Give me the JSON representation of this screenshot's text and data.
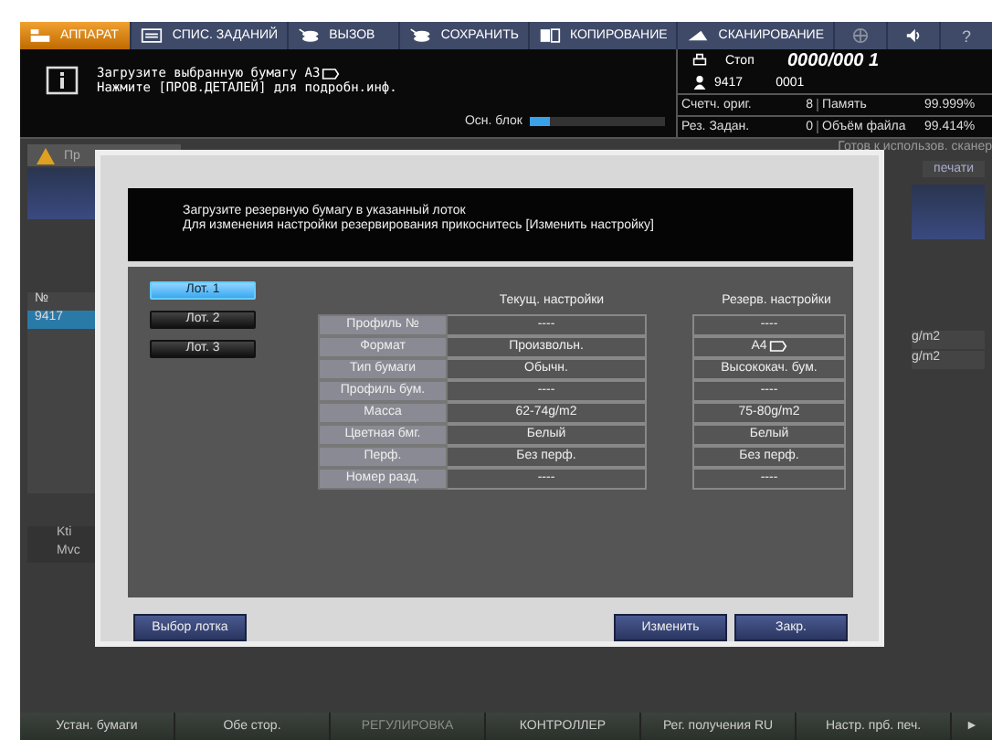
{
  "top_tabs": [
    {
      "label": "АППАРАТ",
      "selected": true
    },
    {
      "label": "СПИС. ЗАДАНИЙ",
      "selected": false
    },
    {
      "label": "ВЫЗОВ",
      "selected": false
    },
    {
      "label": "СОХРАНИТЬ",
      "selected": false
    },
    {
      "label": "КОПИРОВАНИЕ",
      "selected": false
    },
    {
      "label": "СКАНИРОВАНИЕ",
      "selected": false
    }
  ],
  "help_label": "?",
  "info": {
    "lines": [
      "Загрузите выбранную бумагу  А3",
      "Нажмите [ПРОВ.ДЕТАЛЕЙ] для подробн.инф."
    ],
    "status": "Стоп",
    "counter": "0000/000 1",
    "user": "9417",
    "job": "0001",
    "memory_label": "Осн. блок",
    "memory": {
      "level": 0.15
    },
    "stats": [
      {
        "label": "Счетч. ориг.",
        "value": "8",
        "label2": "Память",
        "value2": "99.999%"
      },
      {
        "label": "Рез. Задан.",
        "value": "0",
        "label2": "Объём файла",
        "value2": "99.414%"
      }
    ]
  },
  "background": {
    "warning_tab": "Пр",
    "ready_text": "Готов к использов. сканер",
    "print_text": "печати",
    "list_header": "№",
    "list_row": "9417",
    "weights": [
      "g/m2",
      "g/m2"
    ],
    "devices": [
      "Kti",
      "Mvc"
    ]
  },
  "dialog": {
    "message": [
      "Загрузите резервную бумагу в указанный лоток",
      "Для изменения настройки резервирования прикоснитесь [Изменить настройку]"
    ],
    "trays": [
      {
        "label": "Лот. 1",
        "selected": true
      },
      {
        "label": "Лот. 2",
        "selected": false
      },
      {
        "label": "Лот. 3",
        "selected": false
      }
    ],
    "current_header": "Текущ. настройки",
    "reserve_header": "Резерв. настройки",
    "rows": [
      {
        "label": "Профиль №",
        "current": "----",
        "reserve": "----"
      },
      {
        "label": "Формат",
        "current": "Произвольн.",
        "reserve": "A4"
      },
      {
        "label": "Тип бумаги",
        "current": "Обычн.",
        "reserve": "Высококач. бум."
      },
      {
        "label": "Профиль бум.",
        "current": "----",
        "reserve": "----"
      },
      {
        "label": "Масса",
        "current": "62-74g/m2",
        "reserve": "75-80g/m2"
      },
      {
        "label": "Цветная бмг.",
        "current": "Белый",
        "reserve": "Белый"
      },
      {
        "label": "Перф.",
        "current": "Без перф.",
        "reserve": "Без перф."
      },
      {
        "label": "Номер разд.",
        "current": "----",
        "reserve": "----"
      }
    ],
    "buttons": [
      "Выбор лотка",
      "Изменить",
      "Закр."
    ]
  },
  "bottom_tabs": [
    {
      "label": "Устан. бумаги",
      "disabled": false
    },
    {
      "label": "Обе стор.",
      "disabled": false
    },
    {
      "label": "РЕГУЛИРОВКА",
      "disabled": true
    },
    {
      "label": "КОНТРОЛЛЕР",
      "disabled": false
    },
    {
      "label": "Рег. получения RU",
      "disabled": false
    },
    {
      "label": "Настр. прб. печ.",
      "disabled": false
    }
  ],
  "next_label": "►"
}
